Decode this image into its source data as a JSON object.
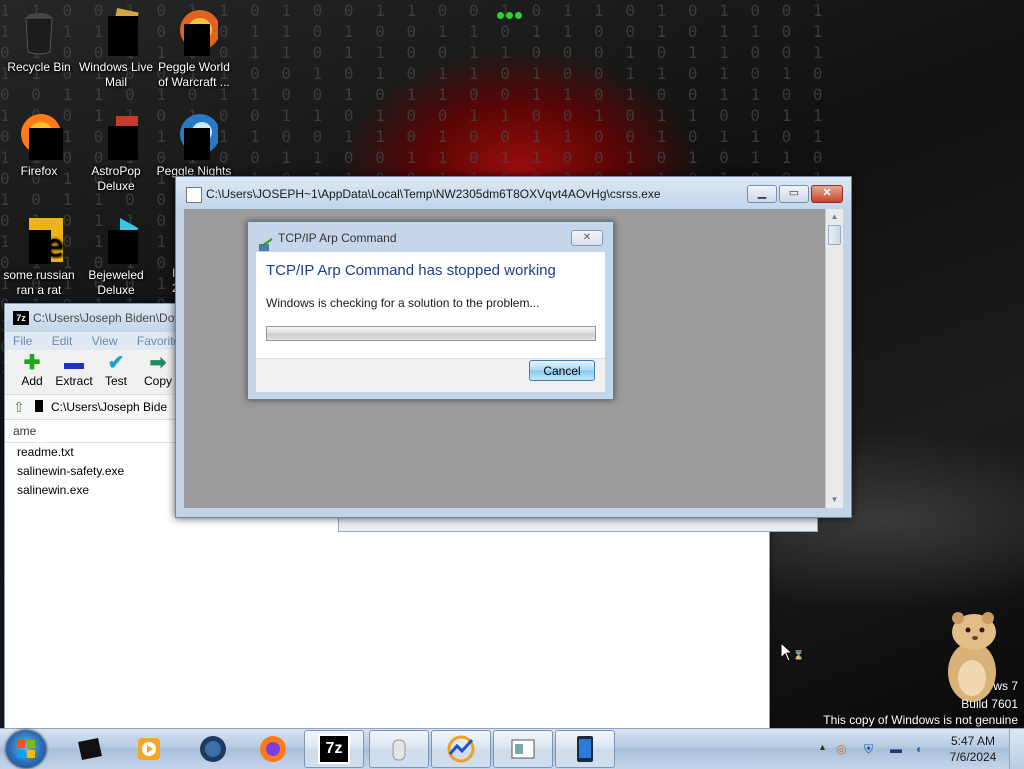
{
  "desktop": {
    "icons": [
      {
        "label": "Recycle Bin",
        "icon": "recycle-bin-icon"
      },
      {
        "label": "Windows Live Mail",
        "icon": "windows-live-mail-icon"
      },
      {
        "label": "Peggle World of Warcraft ...",
        "icon": "peggle-wow-icon"
      },
      {
        "label": "Firefox",
        "icon": "firefox-icon"
      },
      {
        "label": "AstroPop Deluxe",
        "icon": "astropop-icon"
      },
      {
        "label": "Peggle Nights",
        "icon": "peggle-nights-icon"
      },
      {
        "label": "some russian ran a rat",
        "icon": "exe-icon"
      },
      {
        "label": "Bejeweled Deluxe",
        "icon": "bejeweled-icon"
      }
    ],
    "partial_labels": [
      "I",
      "2"
    ]
  },
  "zip_window": {
    "title": "C:\\Users\\Joseph Biden\\Dov",
    "app_icon_text": "7z",
    "menu": [
      "File",
      "Edit",
      "View",
      "Favorites"
    ],
    "toolbar": [
      {
        "label": "Add",
        "icon": "plus-icon"
      },
      {
        "label": "Extract",
        "icon": "minus-icon"
      },
      {
        "label": "Test",
        "icon": "check-icon"
      },
      {
        "label": "Copy",
        "icon": "copy-arrow-icon"
      }
    ],
    "address": "C:\\Users\\Joseph Bide",
    "column_header": "ame",
    "files": [
      "readme.txt",
      "salinewin-safety.exe",
      "salinewin.exe"
    ]
  },
  "main_window": {
    "title": "C:\\Users\\JOSEPH~1\\AppData\\Local\\Temp\\NW2305dm6T8OXVqvt4AOvHg\\csrss.exe"
  },
  "dialog": {
    "title": "TCP/IP Arp Command",
    "heading": "TCP/IP Arp Command has stopped working",
    "message": "Windows is checking for a solution to the problem...",
    "cancel_label": "Cancel",
    "progress": 0.0
  },
  "watermark": {
    "line1": "ws 7",
    "line2": "Build 7601",
    "line3": "This copy of Windows is not genuine"
  },
  "taskbar": {
    "items": [
      "black-box-icon",
      "media-player-icon",
      "globe-icon",
      "firefox-icon",
      "7zip-icon",
      "tissue-icon",
      "stats-icon",
      "window-icon",
      "tablet-icon"
    ],
    "seven_zip_label": "7z",
    "clock_time": "5:47 AM",
    "clock_date": "7/6/2024"
  }
}
